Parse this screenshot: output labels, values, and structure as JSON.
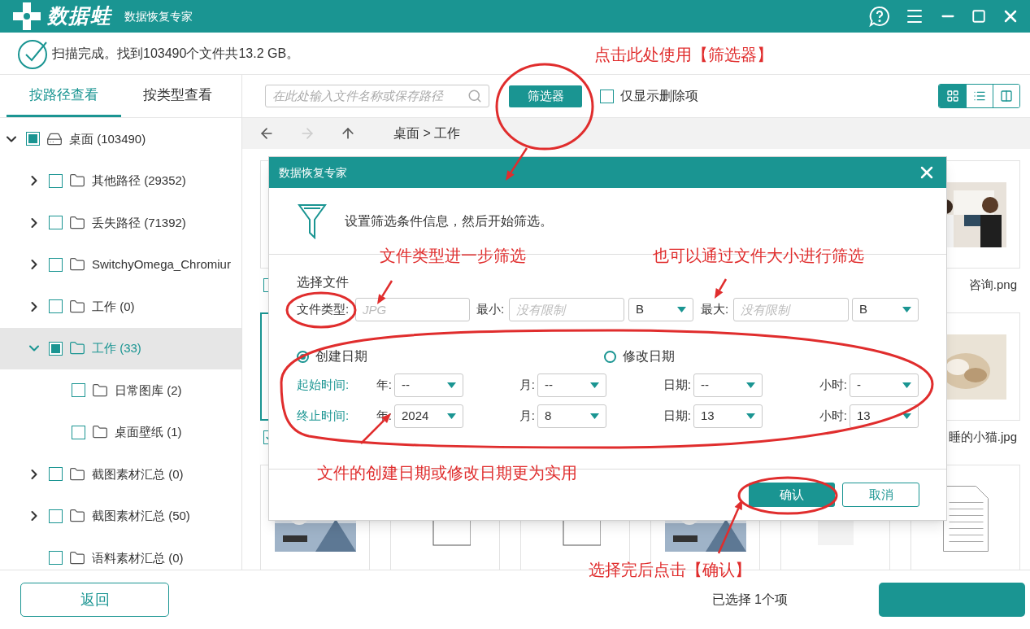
{
  "app": {
    "logo": "数据蛙",
    "subtitle": "数据恢复专家"
  },
  "scan_status": "扫描完成。找到103490个文件共13.2 GB。",
  "view_tabs": [
    {
      "label": "按路径查看",
      "selected": true
    },
    {
      "label": "按类型查看",
      "selected": false
    }
  ],
  "tree": [
    {
      "label": "桌面 (103490)",
      "kind": "drive",
      "expanded": true,
      "partial": true,
      "selected": false,
      "children": [
        {
          "label": "其他路径 (29352)",
          "kind": "folder",
          "expanded": false,
          "partial": false,
          "selected": false
        },
        {
          "label": "丢失路径 (71392)",
          "kind": "folder",
          "expanded": false,
          "partial": false,
          "selected": false
        },
        {
          "label": "SwitchyOmega_Chromiur",
          "kind": "folder",
          "expanded": false,
          "partial": false,
          "selected": false
        },
        {
          "label": "工作 (0)",
          "kind": "folder",
          "expanded": false,
          "partial": false,
          "selected": false
        },
        {
          "label": "工作 (33)",
          "kind": "folder",
          "expanded": true,
          "partial": true,
          "selected": true,
          "children": [
            {
              "label": "日常图库 (2)",
              "kind": "folder",
              "partial": false,
              "selected": false
            },
            {
              "label": "桌面壁纸 (1)",
              "kind": "folder",
              "partial": false,
              "selected": false
            }
          ]
        },
        {
          "label": "截图素材汇总 (0)",
          "kind": "folder",
          "expanded": false,
          "partial": false,
          "selected": false
        },
        {
          "label": "截图素材汇总 (50)",
          "kind": "folder",
          "expanded": false,
          "partial": false,
          "selected": false
        },
        {
          "label": "语料素材汇总 (0)",
          "kind": "folder",
          "partial": false,
          "selected": false
        }
      ]
    }
  ],
  "toolbar": {
    "search_placeholder": "在此处输入文件名称或保存路径",
    "filter_button": "筛选器",
    "deleted_only": {
      "label": "仅显示删除项",
      "checked": false
    },
    "view_modes": [
      {
        "kind": "grid",
        "selected": true
      },
      {
        "kind": "list",
        "selected": false
      },
      {
        "kind": "columns",
        "selected": false
      }
    ]
  },
  "nav": {
    "buttons": [
      {
        "kind": "back",
        "disabled": false
      },
      {
        "kind": "forward",
        "disabled": true
      },
      {
        "kind": "up",
        "disabled": false
      }
    ],
    "breadcrumb": "桌面 > 工作"
  },
  "file_rows": [
    [
      {
        "kind": "card",
        "checked": false,
        "selected": false
      },
      {
        "kind": "covered"
      },
      {
        "kind": "covered"
      },
      {
        "kind": "covered"
      },
      {
        "kind": "covered"
      },
      {
        "kind": "people",
        "name": "咨询.png"
      }
    ],
    [
      {
        "kind": "card",
        "checked": true,
        "selected": true
      },
      {
        "kind": "covered"
      },
      {
        "kind": "covered"
      },
      {
        "kind": "covered"
      },
      {
        "kind": "covered"
      },
      {
        "kind": "cat",
        "name": "睡的小猫.jpg"
      }
    ],
    [
      {
        "kind": "picture"
      },
      {
        "kind": "word"
      },
      {
        "kind": "slides"
      },
      {
        "kind": "picture"
      },
      {
        "kind": "pdf"
      },
      {
        "kind": "doc"
      }
    ]
  ],
  "dialog": {
    "title": "数据恢复专家",
    "intro": "设置筛选条件信息，然后开始筛选。",
    "section": "选择文件",
    "file_type": {
      "label": "文件类型:",
      "placeholder": "JPG"
    },
    "min": {
      "label": "最小:",
      "placeholder": "没有限制",
      "unit": "B"
    },
    "max": {
      "label": "最大:",
      "placeholder": "没有限制",
      "unit": "B"
    },
    "date_modes": [
      {
        "label": "创建日期",
        "selected": true
      },
      {
        "label": "修改日期",
        "selected": false
      }
    ],
    "time_rows": [
      {
        "label": "起始时间:",
        "fields": [
          {
            "label": "年:",
            "value": "--"
          },
          {
            "label": "月:",
            "value": "--"
          },
          {
            "label": "日期:",
            "value": "--"
          },
          {
            "label": "小时:",
            "value": "-"
          }
        ]
      },
      {
        "label": "终止时间:",
        "fields": [
          {
            "label": "年:",
            "value": "2024"
          },
          {
            "label": "月:",
            "value": "8"
          },
          {
            "label": "日期:",
            "value": "13"
          },
          {
            "label": "小时:",
            "value": "13"
          }
        ]
      }
    ],
    "confirm": "确认",
    "cancel": "取消"
  },
  "footer": {
    "back": "返回",
    "selection": "已选择 1个项"
  },
  "annotations": [
    "点击此处使用【筛选器】",
    "文件类型进一步筛选",
    "也可以通过文件大小进行筛选",
    "文件的创建日期或修改日期更为实用",
    "选择完后点击【确认】"
  ]
}
